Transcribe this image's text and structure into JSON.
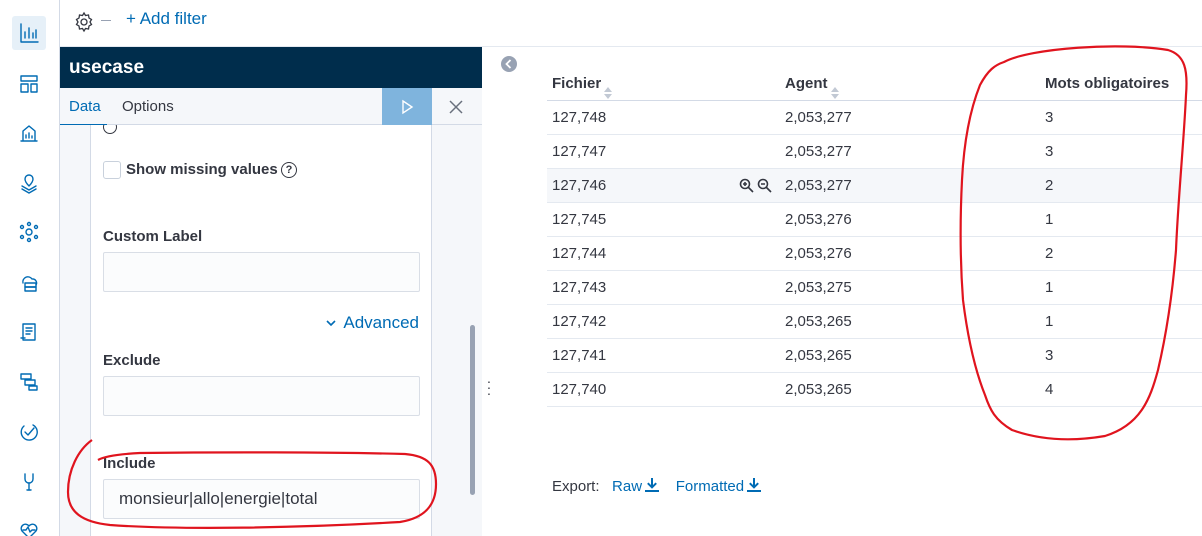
{
  "filter_bar": {
    "add_filter": "+ Add filter"
  },
  "editor": {
    "title": "usecase",
    "tabs": {
      "data": "Data",
      "options": "Options"
    },
    "show_missing_label": "Show missing values",
    "custom_label": {
      "label": "Custom Label",
      "value": ""
    },
    "advanced_label": "Advanced",
    "exclude": {
      "label": "Exclude",
      "value": ""
    },
    "include": {
      "label": "Include",
      "value": "monsieur|allo|energie|total"
    }
  },
  "table": {
    "headers": [
      "Fichier",
      "Agent",
      "Mots obligatoires"
    ],
    "rows": [
      [
        "127,748",
        "2,053,277",
        "3"
      ],
      [
        "127,747",
        "2,053,277",
        "3"
      ],
      [
        "127,746",
        "2,053,277",
        "2"
      ],
      [
        "127,745",
        "2,053,276",
        "1"
      ],
      [
        "127,744",
        "2,053,276",
        "2"
      ],
      [
        "127,743",
        "2,053,275",
        "1"
      ],
      [
        "127,742",
        "2,053,265",
        "1"
      ],
      [
        "127,741",
        "2,053,265",
        "3"
      ],
      [
        "127,740",
        "2,053,265",
        "4"
      ]
    ]
  },
  "export": {
    "label": "Export:",
    "raw": "Raw",
    "formatted": "Formatted"
  },
  "colors": {
    "accent": "#006bb4",
    "title_bar": "#002d4c",
    "annotation": "#e0141e"
  }
}
